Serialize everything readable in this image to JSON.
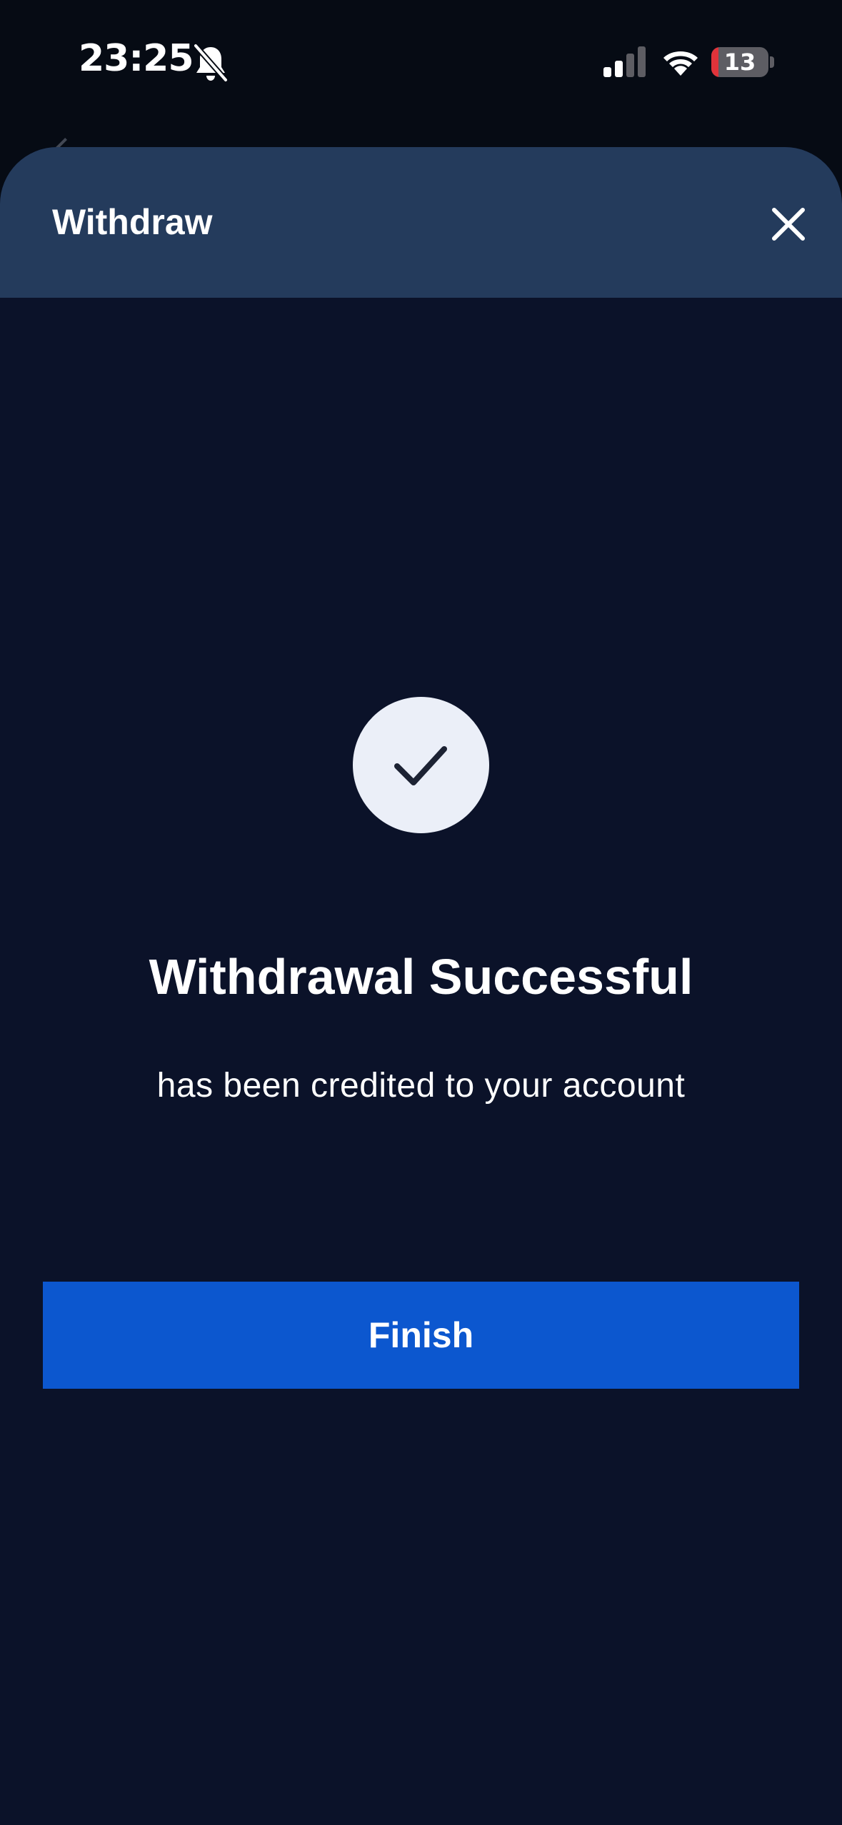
{
  "status_bar": {
    "time": "23:25",
    "battery_level": "13",
    "battery_fraction": 0.13,
    "icons": [
      "bell-off-icon",
      "cellular-signal-icon",
      "wifi-icon",
      "battery-icon"
    ]
  },
  "sheet": {
    "title": "Withdraw",
    "close_icon": "close-icon"
  },
  "result": {
    "icon": "checkmark-icon",
    "title": "Withdrawal Successful",
    "subtitle": "has been credited to your account"
  },
  "actions": {
    "finish_label": "Finish"
  },
  "colors": {
    "background": "#060b14",
    "sheet_background": "#0b1229",
    "header_background": "#243b5c",
    "primary_button": "#0c57cf",
    "check_circle": "#ebeff8",
    "battery_low": "#e0333a"
  }
}
